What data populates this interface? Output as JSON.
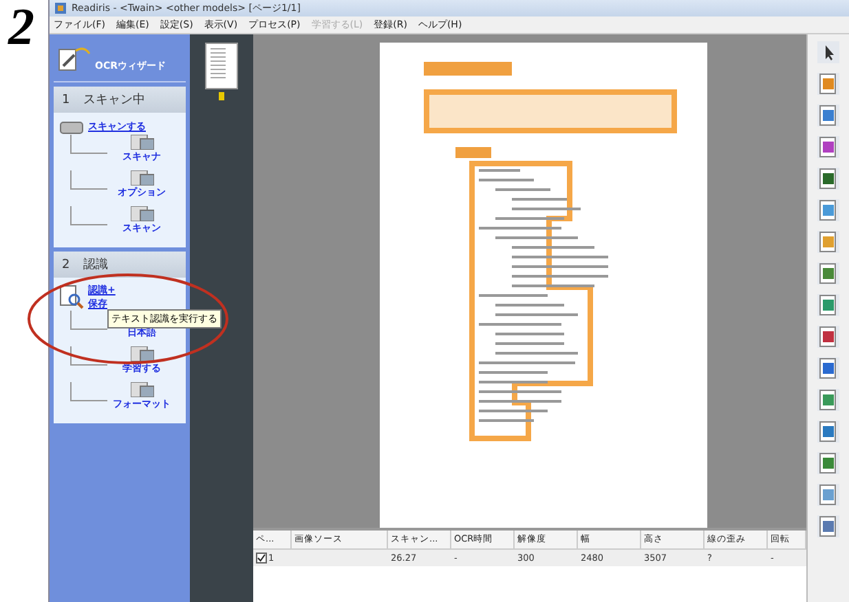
{
  "step_number": "2",
  "window": {
    "title": "Readiris - <Twain> <other models> [ページ1/1]"
  },
  "menu": [
    {
      "label": "ファイル(F)",
      "disabled": false
    },
    {
      "label": "編集(E)",
      "disabled": false
    },
    {
      "label": "設定(S)",
      "disabled": false
    },
    {
      "label": "表示(V)",
      "disabled": false
    },
    {
      "label": "プロセス(P)",
      "disabled": false
    },
    {
      "label": "学習する(L)",
      "disabled": true
    },
    {
      "label": "登録(R)",
      "disabled": false
    },
    {
      "label": "ヘルプ(H)",
      "disabled": false
    }
  ],
  "wizard": {
    "title": "OCRウィザード",
    "sections": [
      {
        "number": "1",
        "title": "スキャン中",
        "main": [
          "スキャンする"
        ],
        "steps": [
          "スキャナ",
          "オプション",
          "スキャン"
        ]
      },
      {
        "number": "2",
        "title": "認識",
        "main": [
          "認識+",
          "保存"
        ],
        "steps": [
          "日本語",
          "学習する",
          "フォーマット"
        ]
      }
    ],
    "tooltip": "テキスト認識を実行する"
  },
  "table": {
    "columns": [
      "ペ...",
      "画像ソース",
      "スキャン...",
      "OCR時間",
      "解像度",
      "幅",
      "高さ",
      "線の歪み",
      "回転"
    ],
    "rows": [
      {
        "checked": true,
        "cells": [
          "1",
          "",
          "26.27",
          "-",
          "300",
          "2480",
          "3507",
          "?",
          "-"
        ]
      }
    ]
  }
}
